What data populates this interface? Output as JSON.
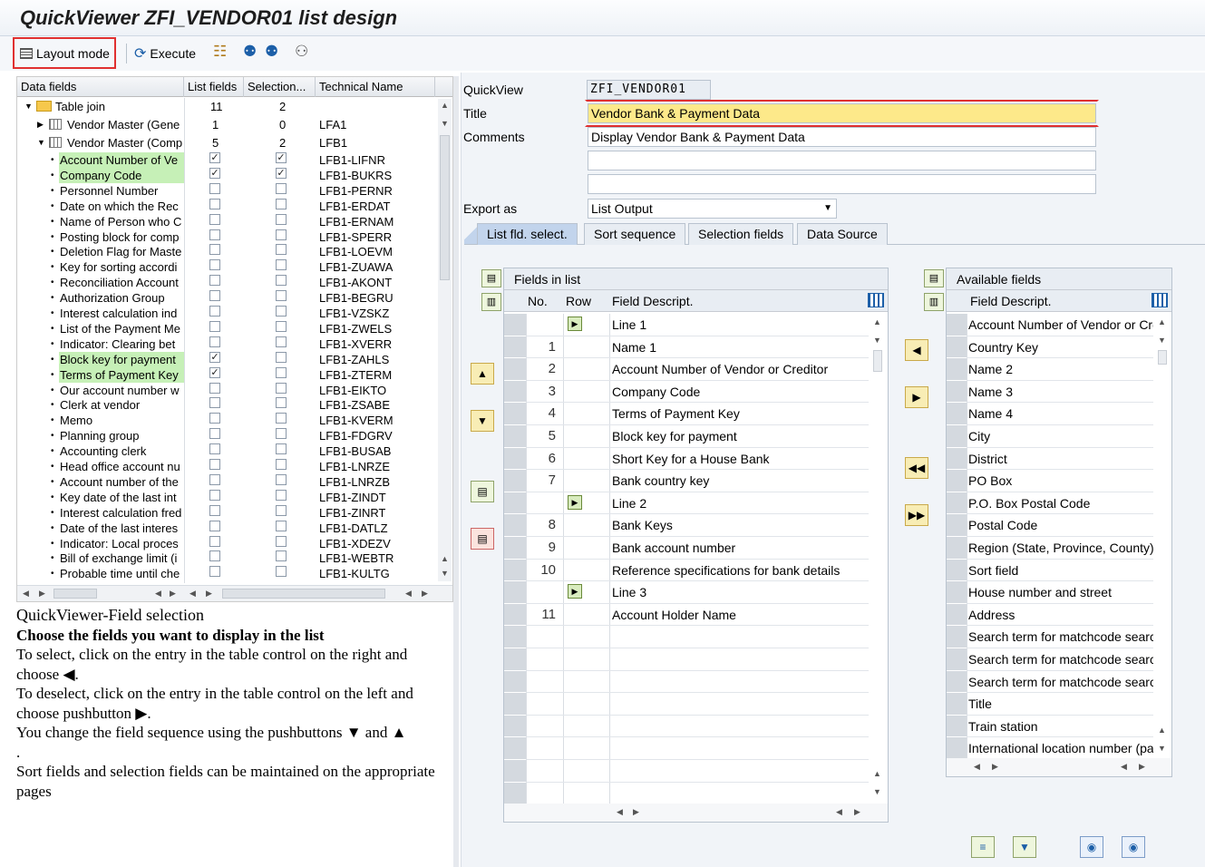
{
  "window": {
    "title": "QuickViewer ZFI_VENDOR01 list design"
  },
  "toolbar": {
    "layout_mode": "Layout mode",
    "execute": "Execute"
  },
  "tree": {
    "headers": [
      "Data fields",
      "List fields",
      "Selection...",
      "Technical Name"
    ],
    "table_join": {
      "label": "Table join",
      "list": "11",
      "sel": "2"
    },
    "groups": [
      {
        "label": "Vendor Master (Gene",
        "list": "1",
        "sel": "0",
        "tech": "LFA1"
      },
      {
        "label": "Vendor Master (Comp",
        "list": "5",
        "sel": "2",
        "tech": "LFB1"
      }
    ],
    "rows": [
      {
        "label": "Account Number of Ve",
        "list": true,
        "sel": true,
        "tech": "LFB1-LIFNR",
        "hl": true
      },
      {
        "label": "Company Code",
        "list": true,
        "sel": true,
        "tech": "LFB1-BUKRS",
        "hl": true
      },
      {
        "label": "Personnel Number",
        "list": false,
        "sel": false,
        "tech": "LFB1-PERNR",
        "hl": false
      },
      {
        "label": "Date on which the Rec",
        "list": false,
        "sel": false,
        "tech": "LFB1-ERDAT",
        "hl": false
      },
      {
        "label": "Name of Person who C",
        "list": false,
        "sel": false,
        "tech": "LFB1-ERNAM",
        "hl": false
      },
      {
        "label": "Posting block for comp",
        "list": false,
        "sel": false,
        "tech": "LFB1-SPERR",
        "hl": false
      },
      {
        "label": "Deletion Flag for Maste",
        "list": false,
        "sel": false,
        "tech": "LFB1-LOEVM",
        "hl": false
      },
      {
        "label": "Key for sorting accordi",
        "list": false,
        "sel": false,
        "tech": "LFB1-ZUAWA",
        "hl": false
      },
      {
        "label": "Reconciliation Account",
        "list": false,
        "sel": false,
        "tech": "LFB1-AKONT",
        "hl": false
      },
      {
        "label": "Authorization Group",
        "list": false,
        "sel": false,
        "tech": "LFB1-BEGRU",
        "hl": false
      },
      {
        "label": "Interest calculation ind",
        "list": false,
        "sel": false,
        "tech": "LFB1-VZSKZ",
        "hl": false
      },
      {
        "label": "List of the Payment Me",
        "list": false,
        "sel": false,
        "tech": "LFB1-ZWELS",
        "hl": false
      },
      {
        "label": "Indicator: Clearing bet",
        "list": false,
        "sel": false,
        "tech": "LFB1-XVERR",
        "hl": false
      },
      {
        "label": "Block key for payment",
        "list": true,
        "sel": false,
        "tech": "LFB1-ZAHLS",
        "hl": true
      },
      {
        "label": "Terms of Payment Key",
        "list": true,
        "sel": false,
        "tech": "LFB1-ZTERM",
        "hl": true
      },
      {
        "label": "Our account number w",
        "list": false,
        "sel": false,
        "tech": "LFB1-EIKTO",
        "hl": false
      },
      {
        "label": "Clerk at vendor",
        "list": false,
        "sel": false,
        "tech": "LFB1-ZSABE",
        "hl": false
      },
      {
        "label": "Memo",
        "list": false,
        "sel": false,
        "tech": "LFB1-KVERM",
        "hl": false
      },
      {
        "label": "Planning group",
        "list": false,
        "sel": false,
        "tech": "LFB1-FDGRV",
        "hl": false
      },
      {
        "label": "Accounting clerk",
        "list": false,
        "sel": false,
        "tech": "LFB1-BUSAB",
        "hl": false
      },
      {
        "label": "Head office account nu",
        "list": false,
        "sel": false,
        "tech": "LFB1-LNRZE",
        "hl": false
      },
      {
        "label": "Account number of the",
        "list": false,
        "sel": false,
        "tech": "LFB1-LNRZB",
        "hl": false
      },
      {
        "label": "Key date of the last int",
        "list": false,
        "sel": false,
        "tech": "LFB1-ZINDT",
        "hl": false
      },
      {
        "label": "Interest calculation fred",
        "list": false,
        "sel": false,
        "tech": "LFB1-ZINRT",
        "hl": false
      },
      {
        "label": "Date of the last interes",
        "list": false,
        "sel": false,
        "tech": "LFB1-DATLZ",
        "hl": false
      },
      {
        "label": "Indicator: Local proces",
        "list": false,
        "sel": false,
        "tech": "LFB1-XDEZV",
        "hl": false
      },
      {
        "label": "Bill of exchange limit (i",
        "list": false,
        "sel": false,
        "tech": "LFB1-WEBTR",
        "hl": false
      },
      {
        "label": "Probable time until che",
        "list": false,
        "sel": false,
        "tech": "LFB1-KULTG",
        "hl": false
      }
    ]
  },
  "help": {
    "title": "QuickViewer-Field selection",
    "subtitle": "Choose the fields you want to display in the list",
    "p1a": "To select, click on the entry in the table control on the right and choose",
    "p2a": "To deselect, click on the entry in the table control on the left and choose pushbutton",
    "p3a": "You change the field sequence using the pushbuttons",
    "p3b": "and",
    "p4": "Sort fields and selection fields can be maintained on the appropriate pages"
  },
  "form": {
    "quickview_label": "QuickView",
    "quickview_value": "ZFI_VENDOR01",
    "title_label": "Title",
    "title_value": "Vendor Bank & Payment Data",
    "comments_label": "Comments",
    "comments_value": "Display Vendor Bank & Payment Data",
    "export_label": "Export as",
    "export_value": "List Output"
  },
  "tabs": [
    "List fld. select.",
    "Sort sequence",
    "Selection fields",
    "Data Source"
  ],
  "fields_in_list": {
    "title": "Fields in list",
    "headers": [
      "No.",
      "Row",
      "Field Descript."
    ],
    "rows": [
      {
        "no": "",
        "line": true,
        "desc": "Line 1"
      },
      {
        "no": "1",
        "line": false,
        "desc": "Name 1"
      },
      {
        "no": "2",
        "line": false,
        "desc": "Account Number of Vendor or Creditor"
      },
      {
        "no": "3",
        "line": false,
        "desc": "Company Code"
      },
      {
        "no": "4",
        "line": false,
        "desc": "Terms of Payment Key"
      },
      {
        "no": "5",
        "line": false,
        "desc": "Block key for payment"
      },
      {
        "no": "6",
        "line": false,
        "desc": "Short Key for a House Bank"
      },
      {
        "no": "7",
        "line": false,
        "desc": "Bank country key"
      },
      {
        "no": "",
        "line": true,
        "desc": "Line 2"
      },
      {
        "no": "8",
        "line": false,
        "desc": "Bank Keys"
      },
      {
        "no": "9",
        "line": false,
        "desc": "Bank account number"
      },
      {
        "no": "10",
        "line": false,
        "desc": "Reference specifications for bank details"
      },
      {
        "no": "",
        "line": true,
        "desc": "Line 3"
      },
      {
        "no": "11",
        "line": false,
        "desc": "Account Holder Name"
      }
    ]
  },
  "available_fields": {
    "title": "Available fields",
    "header": "Field Descript.",
    "rows": [
      "Account Number of Vendor or Cre",
      "Country Key",
      "Name 2",
      "Name 3",
      "Name 4",
      "City",
      "District",
      "PO Box",
      "P.O. Box Postal Code",
      "Postal Code",
      "Region (State, Province, County)",
      "Sort field",
      "House number and street",
      "Address",
      "Search term for matchcode search",
      "Search term for matchcode search",
      "Search term for matchcode search",
      "Title",
      "Train station",
      "International location number  (pa"
    ]
  },
  "colors": {
    "accent": "#c2d4ec",
    "highlight": "#c6f0b7",
    "title_field": "#fde98a",
    "required_red": "#e03030"
  }
}
